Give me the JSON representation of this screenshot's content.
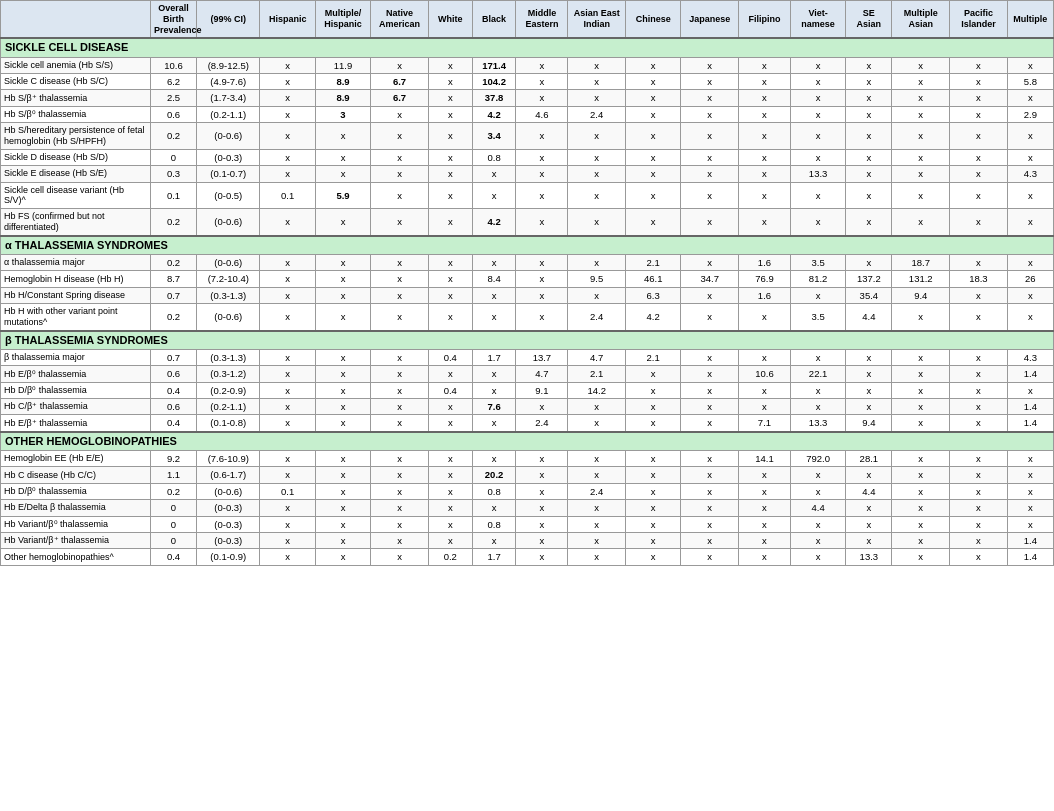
{
  "headers": {
    "row1": [
      "",
      "Overall Birth\nPrevalence",
      "(99% CI)",
      "Hispanic",
      "Multiple/\nHispanic",
      "Native\nAmerican",
      "White",
      "Black",
      "Middle\nEastern",
      "Asian East\nIndian",
      "Chinese",
      "Japanese",
      "Filipino",
      "Viet-\nnamese",
      "SE\nAsian",
      "Multiple\nAsian",
      "Pacific\nIslander",
      "Multiple"
    ]
  },
  "sections": [
    {
      "title": "SICKLE CELL DISEASE",
      "rows": [
        {
          "disease": "Sickle cell anemia (Hb S/S)",
          "prev": "10.6",
          "ci": "(8.9-12.5)",
          "hisp": "x",
          "multHisp": "11.9",
          "native": "x",
          "white": "x",
          "black": "171.4",
          "midEast": "x",
          "asiEast": "x",
          "chinese": "x",
          "japanese": "x",
          "filipino": "x",
          "viet": "x",
          "se": "x",
          "multAsian": "x",
          "pacific": "x",
          "multiple": "x",
          "blackBold": true
        },
        {
          "disease": "Sickle C disease (Hb S/C)",
          "prev": "6.2",
          "ci": "(4.9-7.6)",
          "hisp": "x",
          "multHisp": "8.9",
          "native": "6.7",
          "white": "x",
          "black": "104.2",
          "midEast": "x",
          "asiEast": "x",
          "chinese": "x",
          "japanese": "x",
          "filipino": "x",
          "viet": "x",
          "se": "x",
          "multAsian": "x",
          "pacific": "x",
          "multiple": "5.8",
          "blackBold": true,
          "multHispBold": false,
          "nativeBold": false
        },
        {
          "disease": "Hb S/β⁺ thalassemia",
          "prev": "2.5",
          "ci": "(1.7-3.4)",
          "hisp": "x",
          "multHisp": "8.9",
          "native": "6.7",
          "white": "x",
          "black": "37.8",
          "midEast": "x",
          "asiEast": "x",
          "chinese": "x",
          "japanese": "x",
          "filipino": "x",
          "viet": "x",
          "se": "x",
          "multAsian": "x",
          "pacific": "x",
          "multiple": "x",
          "blackBold": false
        },
        {
          "disease": "Hb S/β⁰ thalassemia",
          "prev": "0.6",
          "ci": "(0.2-1.1)",
          "hisp": "x",
          "multHisp": "3",
          "native": "x",
          "white": "x",
          "black": "4.2",
          "midEast": "4.6",
          "asiEast": "2.4",
          "chinese": "x",
          "japanese": "x",
          "filipino": "x",
          "viet": "x",
          "se": "x",
          "multAsian": "x",
          "pacific": "x",
          "multiple": "2.9",
          "multHispBold": true,
          "blackBold": false
        },
        {
          "disease": "Hb S/hereditary persistence of fetal hemoglobin (Hb S/HPFH)",
          "prev": "0.2",
          "ci": "(0-0.6)",
          "hisp": "x",
          "multHisp": "x",
          "native": "x",
          "white": "x",
          "black": "3.4",
          "midEast": "x",
          "asiEast": "x",
          "chinese": "x",
          "japanese": "x",
          "filipino": "x",
          "viet": "x",
          "se": "x",
          "multAsian": "x",
          "pacific": "x",
          "multiple": "x",
          "blackBold": true
        },
        {
          "disease": "Sickle D disease (Hb S/D)",
          "prev": "0",
          "ci": "(0-0.3)",
          "hisp": "x",
          "multHisp": "x",
          "native": "x",
          "white": "x",
          "black": "0.8",
          "midEast": "x",
          "asiEast": "x",
          "chinese": "x",
          "japanese": "x",
          "filipino": "x",
          "viet": "x",
          "se": "x",
          "multAsian": "x",
          "pacific": "x",
          "multiple": "x"
        },
        {
          "disease": "Sickle E disease (Hb S/E)",
          "prev": "0.3",
          "ci": "(0.1-0.7)",
          "hisp": "x",
          "multHisp": "x",
          "native": "x",
          "white": "x",
          "black": "x",
          "midEast": "x",
          "asiEast": "x",
          "chinese": "x",
          "japanese": "x",
          "filipino": "x",
          "viet": "13.3",
          "se": "x",
          "multAsian": "x",
          "pacific": "x",
          "multiple": "4.3",
          "vietnamBold": false
        },
        {
          "disease": "Sickle cell disease variant (Hb S/V)^",
          "prev": "0.1",
          "ci": "(0-0.5)",
          "hisp": "0.1",
          "multHisp": "5.9",
          "native": "x",
          "white": "x",
          "black": "x",
          "midEast": "x",
          "asiEast": "x",
          "chinese": "x",
          "japanese": "x",
          "filipino": "x",
          "viet": "x",
          "se": "x",
          "multAsian": "x",
          "pacific": "x",
          "multiple": "x",
          "multHispBold": true
        },
        {
          "disease": "Hb FS (confirmed but not differentiated)",
          "prev": "0.2",
          "ci": "(0-0.6)",
          "hisp": "x",
          "multHisp": "x",
          "native": "x",
          "white": "x",
          "black": "4.2",
          "midEast": "x",
          "asiEast": "x",
          "chinese": "x",
          "japanese": "x",
          "filipino": "x",
          "viet": "x",
          "se": "x",
          "multAsian": "x",
          "pacific": "x",
          "multiple": "x",
          "blackBold": false
        }
      ]
    },
    {
      "title": "α THALASSEMIA SYNDROMES",
      "rows": [
        {
          "disease": "α thalassemia major",
          "prev": "0.2",
          "ci": "(0-0.6)",
          "hisp": "x",
          "multHisp": "x",
          "native": "x",
          "white": "x",
          "black": "x",
          "midEast": "x",
          "asiEast": "x",
          "chinese": "2.1",
          "japanese": "x",
          "filipino": "1.6",
          "viet": "3.5",
          "se": "x",
          "multAsian": "18.7",
          "pacific": "x",
          "multiple": "x"
        },
        {
          "disease": "Hemoglobin H disease (Hb H)",
          "prev": "8.7",
          "ci": "(7.2-10.4)",
          "hisp": "x",
          "multHisp": "x",
          "native": "x",
          "white": "x",
          "black": "8.4",
          "midEast": "x",
          "asiEast": "9.5",
          "chinese": "46.1",
          "japanese": "34.7",
          "filipino": "76.9",
          "viet": "81.2",
          "se": "137.2",
          "multAsian": "131.2",
          "pacific": "18.3",
          "multiple": "26"
        },
        {
          "disease": "Hb H/Constant Spring disease",
          "prev": "0.7",
          "ci": "(0.3-1.3)",
          "hisp": "x",
          "multHisp": "x",
          "native": "x",
          "white": "x",
          "black": "x",
          "midEast": "x",
          "asiEast": "x",
          "chinese": "6.3",
          "japanese": "x",
          "filipino": "1.6",
          "viet": "x",
          "se": "35.4",
          "multAsian": "9.4",
          "pacific": "x",
          "multiple": "x"
        },
        {
          "disease": "Hb H with other variant point mutations^",
          "prev": "0.2",
          "ci": "(0-0.6)",
          "hisp": "x",
          "multHisp": "x",
          "native": "x",
          "white": "x",
          "black": "x",
          "midEast": "x",
          "asiEast": "2.4",
          "chinese": "4.2",
          "japanese": "x",
          "filipino": "x",
          "viet": "3.5",
          "se": "4.4",
          "multAsian": "x",
          "pacific": "x",
          "multiple": "x"
        }
      ]
    },
    {
      "title": "β THALASSEMIA SYNDROMES",
      "rows": [
        {
          "disease": "β thalassemia major",
          "prev": "0.7",
          "ci": "(0.3-1.3)",
          "hisp": "x",
          "multHisp": "x",
          "native": "x",
          "white": "0.4",
          "black": "1.7",
          "midEast": "13.7",
          "asiEast": "4.7",
          "chinese": "2.1",
          "japanese": "x",
          "filipino": "x",
          "viet": "x",
          "se": "x",
          "multAsian": "x",
          "pacific": "x",
          "multiple": "4.3"
        },
        {
          "disease": "Hb E/β⁰ thalassemia",
          "prev": "0.6",
          "ci": "(0.3-1.2)",
          "hisp": "x",
          "multHisp": "x",
          "native": "x",
          "white": "x",
          "black": "x",
          "midEast": "4.7",
          "asiEast": "2.1",
          "chinese": "x",
          "japanese": "x",
          "filipino": "10.6",
          "viet": "22.1",
          "se": "x",
          "multAsian": "x",
          "pacific": "x",
          "multiple": "1.4"
        },
        {
          "disease": "Hb D/β⁰ thalassemia",
          "prev": "0.4",
          "ci": "(0.2-0.9)",
          "hisp": "x",
          "multHisp": "x",
          "native": "x",
          "white": "0.4",
          "black": "x",
          "midEast": "9.1",
          "asiEast": "14.2",
          "chinese": "x",
          "japanese": "x",
          "filipino": "x",
          "viet": "x",
          "se": "x",
          "multAsian": "x",
          "pacific": "x",
          "multiple": "x"
        },
        {
          "disease": "Hb C/β⁺ thalassemia",
          "prev": "0.6",
          "ci": "(0.2-1.1)",
          "hisp": "x",
          "multHisp": "x",
          "native": "x",
          "white": "x",
          "black": "7.6",
          "midEast": "x",
          "asiEast": "x",
          "chinese": "x",
          "japanese": "x",
          "filipino": "x",
          "viet": "x",
          "se": "x",
          "multAsian": "x",
          "pacific": "x",
          "multiple": "1.4",
          "blackBold": true
        },
        {
          "disease": "Hb E/β⁺ thalassemia",
          "prev": "0.4",
          "ci": "(0.1-0.8)",
          "hisp": "x",
          "multHisp": "x",
          "native": "x",
          "white": "x",
          "black": "x",
          "midEast": "2.4",
          "asiEast": "x",
          "chinese": "x",
          "japanese": "x",
          "filipino": "7.1",
          "viet": "13.3",
          "se": "9.4",
          "multAsian": "x",
          "pacific": "x",
          "multiple": "1.4"
        }
      ]
    },
    {
      "title": "OTHER HEMOGLOBINOPATHIES",
      "rows": [
        {
          "disease": "Hemoglobin EE (Hb E/E)",
          "prev": "9.2",
          "ci": "(7.6-10.9)",
          "hisp": "x",
          "multHisp": "x",
          "native": "x",
          "white": "x",
          "black": "x",
          "midEast": "x",
          "asiEast": "x",
          "chinese": "x",
          "japanese": "x",
          "filipino": "14.1",
          "viet": "792.0",
          "se": "28.1",
          "multAsian": "x",
          "pacific": "x",
          "multiple": "x"
        },
        {
          "disease": "Hb C disease (Hb C/C)",
          "prev": "1.1",
          "ci": "(0.6-1.7)",
          "hisp": "x",
          "multHisp": "x",
          "native": "x",
          "white": "x",
          "black": "20.2",
          "midEast": "x",
          "asiEast": "x",
          "chinese": "x",
          "japanese": "x",
          "filipino": "x",
          "viet": "x",
          "se": "x",
          "multAsian": "x",
          "pacific": "x",
          "multiple": "x",
          "blackBold": true
        },
        {
          "disease": "Hb D/β⁰ thalassemia",
          "prev": "0.2",
          "ci": "(0-0.6)",
          "hisp": "0.1",
          "multHisp": "x",
          "native": "x",
          "white": "x",
          "black": "0.8",
          "midEast": "x",
          "asiEast": "2.4",
          "chinese": "x",
          "japanese": "x",
          "filipino": "x",
          "viet": "x",
          "se": "4.4",
          "multAsian": "x",
          "pacific": "x",
          "multiple": "x"
        },
        {
          "disease": "Hb E/Delta β thalassemia",
          "prev": "0",
          "ci": "(0-0.3)",
          "hisp": "x",
          "multHisp": "x",
          "native": "x",
          "white": "x",
          "black": "x",
          "midEast": "x",
          "asiEast": "x",
          "chinese": "x",
          "japanese": "x",
          "filipino": "x",
          "viet": "4.4",
          "se": "x",
          "multAsian": "x",
          "pacific": "x",
          "multiple": "x"
        },
        {
          "disease": "Hb Variant/β⁰ thalassemia",
          "prev": "0",
          "ci": "(0-0.3)",
          "hisp": "x",
          "multHisp": "x",
          "native": "x",
          "white": "x",
          "black": "0.8",
          "midEast": "x",
          "asiEast": "x",
          "chinese": "x",
          "japanese": "x",
          "filipino": "x",
          "viet": "x",
          "se": "x",
          "multAsian": "x",
          "pacific": "x",
          "multiple": "x"
        },
        {
          "disease": "Hb Variant/β⁺ thalassemia",
          "prev": "0",
          "ci": "(0-0.3)",
          "hisp": "x",
          "multHisp": "x",
          "native": "x",
          "white": "x",
          "black": "x",
          "midEast": "x",
          "asiEast": "x",
          "chinese": "x",
          "japanese": "x",
          "filipino": "x",
          "viet": "x",
          "se": "x",
          "multAsian": "x",
          "pacific": "x",
          "multiple": "1.4"
        },
        {
          "disease": "Other hemoglobinopathies^",
          "prev": "0.4",
          "ci": "(0.1-0.9)",
          "hisp": "x",
          "multHisp": "x",
          "native": "x",
          "white": "0.2",
          "black": "1.7",
          "midEast": "x",
          "asiEast": "x",
          "chinese": "x",
          "japanese": "x",
          "filipino": "x",
          "viet": "x",
          "se": "13.3",
          "multAsian": "x",
          "pacific": "x",
          "multiple": "1.4"
        }
      ]
    }
  ]
}
